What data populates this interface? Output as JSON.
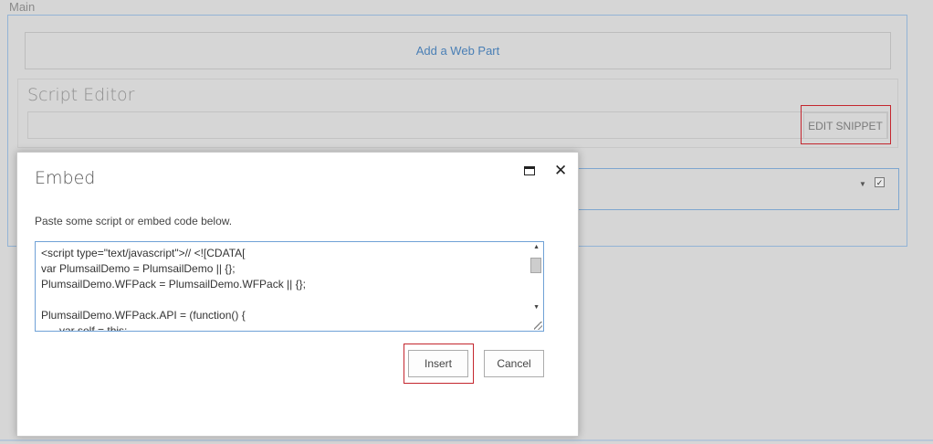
{
  "page": {
    "zone_label": "Main",
    "add_web_part": "Add a Web Part",
    "script_editor": {
      "title": "Script Editor",
      "edit_snippet": "EDIT SNIPPET"
    },
    "second_webpart": {
      "checkbox_checked": true,
      "checkbox_glyph": "✓"
    }
  },
  "dialog": {
    "title": "Embed",
    "instructions": "Paste some script or embed code below.",
    "code": "<script type=\"text/javascript\">// <![CDATA[\nvar PlumsailDemo = PlumsailDemo || {};\nPlumsailDemo.WFPack = PlumsailDemo.WFPack || {};\n\nPlumsailDemo.WFPack.API = (function() {\n      var self = this;",
    "buttons": {
      "insert": "Insert",
      "cancel": "Cancel"
    },
    "icons": {
      "maximize": "maximize-icon",
      "close": "close-icon",
      "close_glyph": "✕"
    }
  },
  "colors": {
    "highlight": "#c4262e",
    "link": "#4a7fb5",
    "zone_border": "#93b4d6",
    "overlay_bg": "#d6d6d6"
  }
}
